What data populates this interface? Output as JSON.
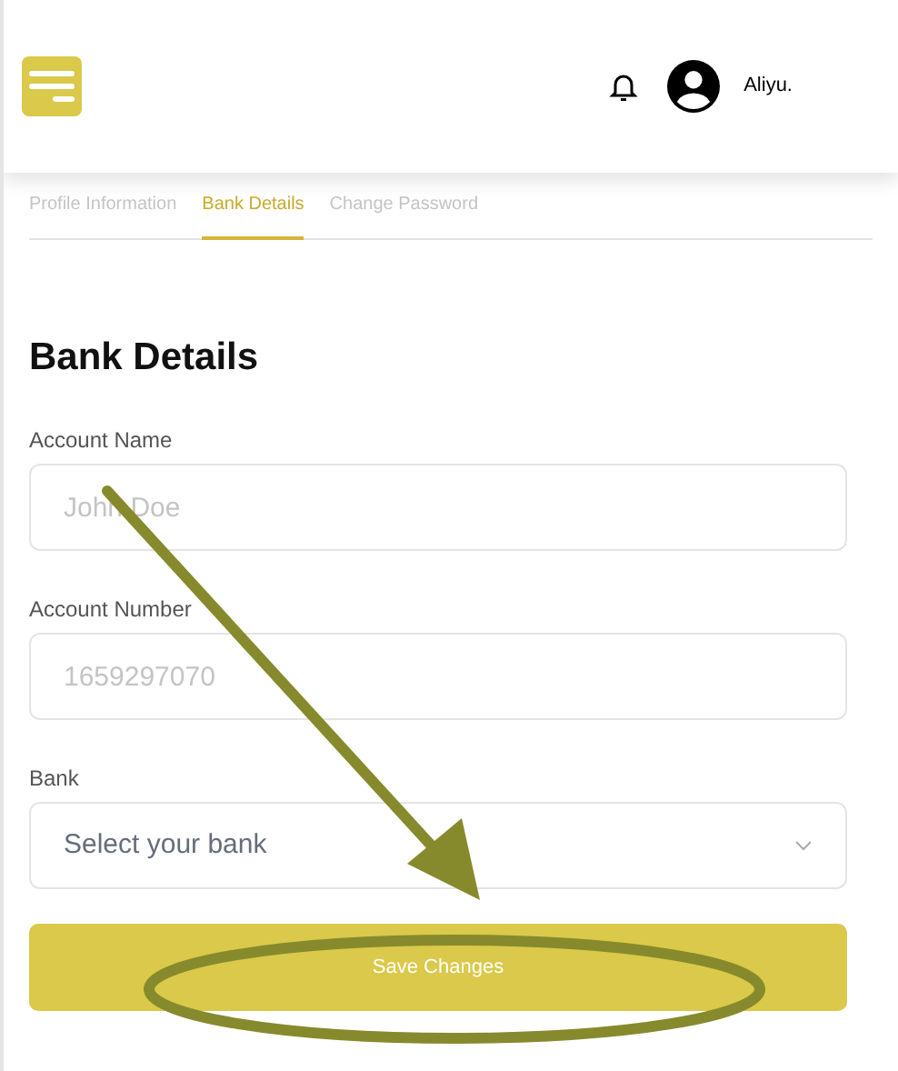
{
  "header": {
    "user_name": "Aliyu."
  },
  "tabs": [
    {
      "label": "Profile Information",
      "selected": false
    },
    {
      "label": "Bank Details",
      "selected": true
    },
    {
      "label": "Change Password",
      "selected": false
    }
  ],
  "section_title": "Bank Details",
  "fields": [
    {
      "kind": "text",
      "label": "Account Name",
      "placeholder": "John Doe"
    },
    {
      "kind": "text",
      "label": "Account Number",
      "placeholder": "1659297070"
    },
    {
      "kind": "select",
      "label": "Bank",
      "placeholder": "Select your bank"
    }
  ],
  "submit_button": "Save Changes"
}
